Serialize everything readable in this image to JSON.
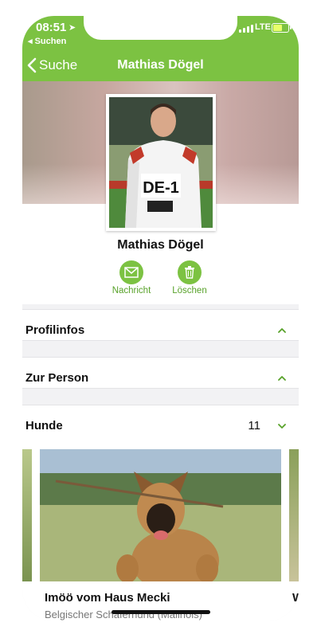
{
  "status_bar": {
    "time": "08:51",
    "back_app_label": "◂ Suchen",
    "network": "LTE",
    "colors": {
      "bar": "#7cc242",
      "battery_fill": "#e8ff6a"
    }
  },
  "nav": {
    "back_label": "Suche",
    "title": "Mathias Dögel"
  },
  "profile": {
    "name": "Mathias Dögel",
    "photo_text": "DE-1",
    "actions": [
      {
        "label": "Nachricht",
        "icon": "envelope-icon"
      },
      {
        "label": "Löschen",
        "icon": "trash-icon"
      }
    ]
  },
  "sections": [
    {
      "title": "Profilinfos",
      "chevron": "chevron-up-icon"
    },
    {
      "title": "Zur Person",
      "chevron": "chevron-up-icon"
    },
    {
      "title": "Hunde",
      "count": "11",
      "chevron": "chevron-down-icon"
    }
  ],
  "dogs": [
    {
      "name": "Imöö vom Haus Mecki",
      "breed": "Belgischer Schäferhund (Malinois)"
    }
  ],
  "next_dog_peek_text": "W",
  "accent_color": "#7cc242",
  "accent_text_color": "#58a22a"
}
